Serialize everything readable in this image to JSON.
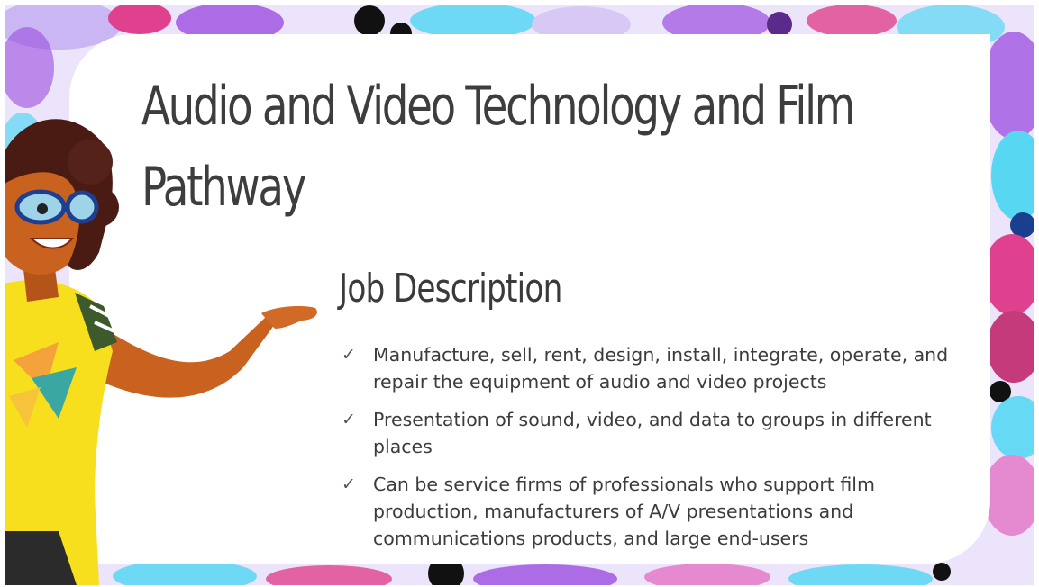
{
  "slide": {
    "title": "Audio and Video Technology and Film Pathway",
    "section_heading": "Job Description",
    "bullets": [
      "Manufacture, sell, rent, design, install, integrate, operate, and repair the equipment of audio and video projects",
      "Presentation of sound, video, and data to groups in different places",
      "Can be service firms of professionals who support film production, manufacturers of A/V presentations and communications products, and large end-users"
    ],
    "bullet_icon": "checkmark-icon",
    "bullet_glyph": "✓"
  },
  "colors": {
    "title_text": "#3d3d3d",
    "body_text": "#3c3c3c",
    "paint_magenta": "#e0418f",
    "paint_purple": "#9b4de0",
    "paint_cyan": "#58d7f3",
    "paint_black": "#111111",
    "shirt_yellow": "#f7df1e",
    "skin": "#c9611f"
  }
}
